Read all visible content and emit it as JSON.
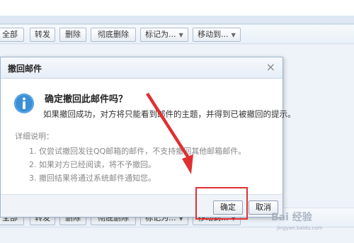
{
  "toolbar": {
    "buttons": [
      {
        "label": "全部",
        "dropdown": false
      },
      {
        "label": "转发",
        "dropdown": false
      },
      {
        "label": "删除",
        "dropdown": false
      },
      {
        "label": "彻底删除",
        "dropdown": false
      },
      {
        "label": "标记为...",
        "dropdown": true
      },
      {
        "label": "移动到...",
        "dropdown": true
      }
    ]
  },
  "dialog": {
    "title": "撤回邮件",
    "close_glyph": "×",
    "question": "确定撤回此邮件吗？",
    "description": "如果撤回成功，对方将只能看到邮件的主题，并得到已被撤回的提示。",
    "detail_heading": "详细说明：",
    "details": [
      "1. 仅尝试撤回发往QQ邮箱的邮件，不支持撤回其他邮箱邮件。",
      "2. 如果对方已经阅读，将不予撤回。",
      "3. 撤回结果将通过系统邮件通知您。"
    ],
    "confirm_label": "确定",
    "cancel_label": "取消",
    "icon": "info-icon"
  },
  "watermark": {
    "text": "Bai 经验",
    "sub": "jingyan.baidu.com"
  },
  "colors": {
    "annotation": "#e03030",
    "info_icon": "#3a8fd6"
  }
}
